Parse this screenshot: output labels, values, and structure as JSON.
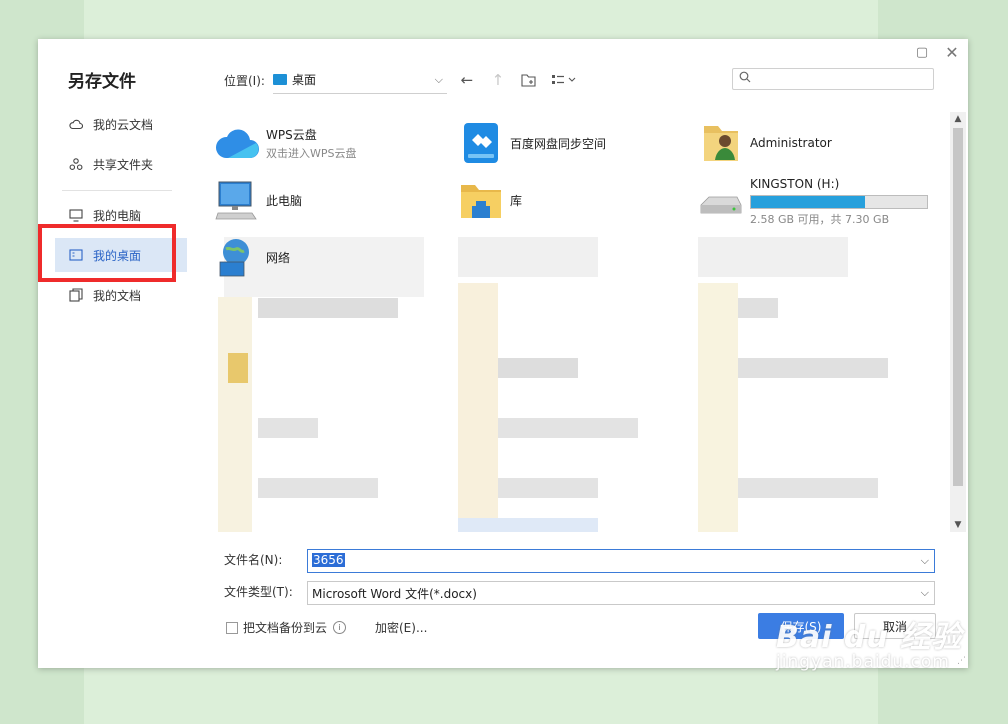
{
  "dialog": {
    "title": "另存文件",
    "accent_color": "#3b7de3",
    "highlight_color": "#ef2b2b"
  },
  "sidebar": {
    "items": [
      {
        "label": "我的云文档",
        "icon": "cloud-doc-icon"
      },
      {
        "label": "共享文件夹",
        "icon": "share-folder-icon"
      },
      {
        "label": "我的电脑",
        "icon": "monitor-icon"
      },
      {
        "label": "我的桌面",
        "icon": "desktop-icon",
        "active": true
      },
      {
        "label": "我的文档",
        "icon": "documents-icon"
      }
    ]
  },
  "toolbar": {
    "location_label": "位置(I):",
    "location_value": "桌面"
  },
  "files": [
    {
      "name": "WPS云盘",
      "sub": "双击进入WPS云盘",
      "icon": "wps-cloud-icon"
    },
    {
      "name": "百度网盘同步空间",
      "icon": "baidu-netdisk-icon"
    },
    {
      "name": "Administrator",
      "icon": "user-folder-icon"
    },
    {
      "name": "此电脑",
      "icon": "computer-icon"
    },
    {
      "name": "库",
      "icon": "library-folder-icon"
    },
    {
      "name": "KINGSTON (H:)",
      "sub": "2.58 GB 可用，共 7.30 GB",
      "icon": "usb-drive-icon",
      "usage_fraction": 0.65
    },
    {
      "name": "网络",
      "icon": "network-icon"
    }
  ],
  "form": {
    "filename_label": "文件名(N):",
    "filename_value": "3656",
    "filetype_label": "文件类型(T):",
    "filetype_value": "Microsoft Word 文件(*.docx)",
    "backup_label": "把文档备份到云",
    "encrypt_label": "加密(E)...",
    "save_label": "保存(S)",
    "cancel_label": "取消"
  },
  "watermark": {
    "logo": "Bai du 经验",
    "url": "jingyan.baidu.com"
  }
}
